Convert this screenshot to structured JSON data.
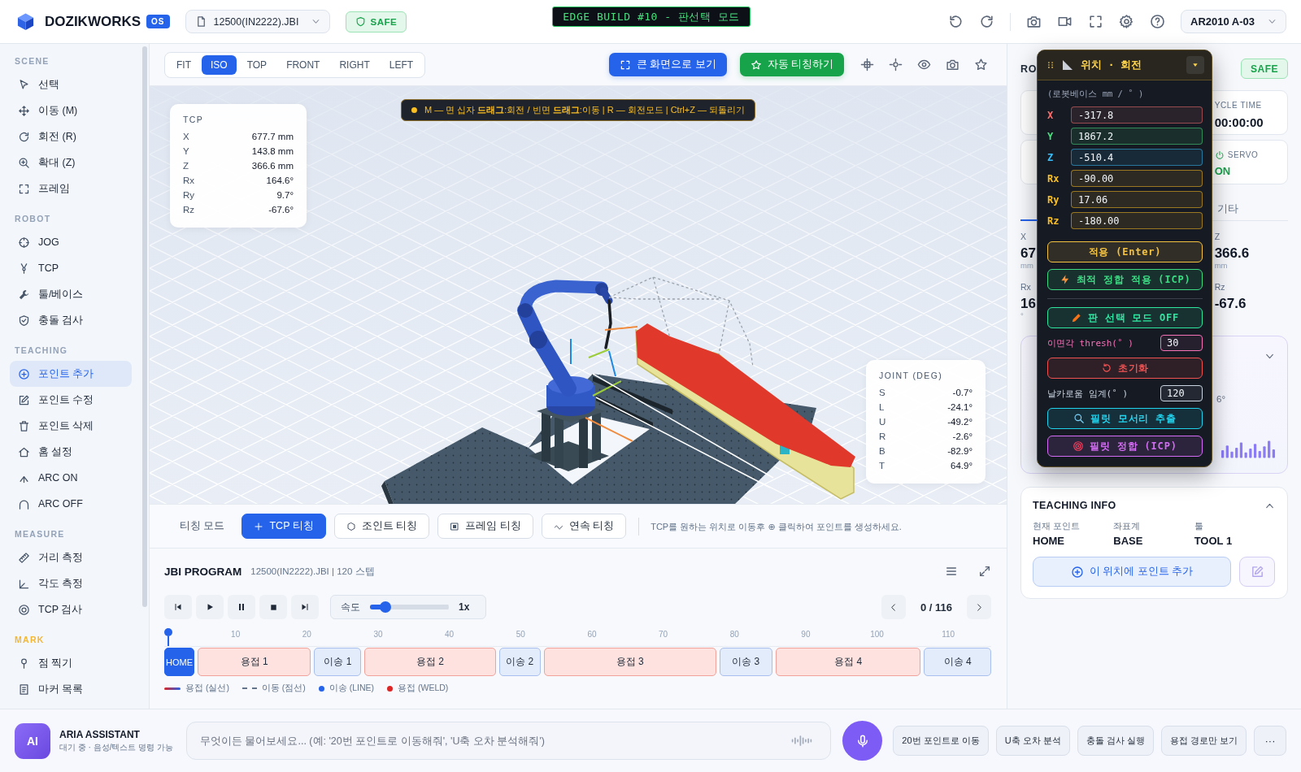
{
  "topbar": {
    "brand": "DOZIKWORKS",
    "brand_badge": "OS",
    "file": "12500(IN2222).JBI",
    "safety": "SAFE",
    "build_banner": "EDGE BUILD #10 - 판선택 모드",
    "robot": "AR2010 A-03"
  },
  "sidebar": {
    "sections": [
      {
        "title": "SCENE",
        "color": "#94a3b8",
        "items": [
          {
            "label": "선택",
            "selected": false
          },
          {
            "label": "이동 (M)",
            "selected": false
          },
          {
            "label": "회전 (R)",
            "selected": false
          },
          {
            "label": "확대 (Z)",
            "selected": false
          },
          {
            "label": "프레임",
            "selected": false
          }
        ]
      },
      {
        "title": "ROBOT",
        "color": "#94a3b8",
        "items": [
          {
            "label": "JOG",
            "selected": false
          },
          {
            "label": "TCP",
            "selected": false
          },
          {
            "label": "툴/베이스",
            "selected": false
          },
          {
            "label": "충돌 검사",
            "selected": false
          }
        ]
      },
      {
        "title": "TEACHING",
        "color": "#94a3b8",
        "items": [
          {
            "label": "포인트 추가",
            "selected": true
          },
          {
            "label": "포인트 수정",
            "selected": false
          },
          {
            "label": "포인트 삭제",
            "selected": false
          },
          {
            "label": "홈 설정",
            "selected": false
          },
          {
            "label": "ARC ON",
            "selected": false
          },
          {
            "label": "ARC OFF",
            "selected": false
          }
        ]
      },
      {
        "title": "MEASURE",
        "color": "#94a3b8",
        "items": [
          {
            "label": "거리 측정",
            "selected": false
          },
          {
            "label": "각도 측정",
            "selected": false
          },
          {
            "label": "TCP 검사",
            "selected": false
          }
        ]
      },
      {
        "title": "MARK",
        "color": "#f5b731",
        "items": [
          {
            "label": "점 찍기",
            "selected": false
          },
          {
            "label": "마커 목록",
            "selected": false
          }
        ]
      }
    ]
  },
  "viewport": {
    "views": [
      {
        "label": "FIT",
        "selected": false
      },
      {
        "label": "ISO",
        "selected": true
      },
      {
        "label": "TOP",
        "selected": false
      },
      {
        "label": "FRONT",
        "selected": false
      },
      {
        "label": "RIGHT",
        "selected": false
      },
      {
        "label": "LEFT",
        "selected": false
      }
    ],
    "actions": [
      {
        "label": "큰 화면으로 보기",
        "kind": "primary"
      },
      {
        "label": "자동 티칭하기",
        "kind": "success"
      }
    ],
    "hint": "M — 면 십자 **드래그**:회전 / 빈면 **드래그**:이동 | R — 회전모드 | Ctrl+Z — 되돌리기",
    "tcp": {
      "title": "TCP",
      "rows": [
        {
          "label": "X",
          "value": "677.7 mm"
        },
        {
          "label": "Y",
          "value": "143.8 mm"
        },
        {
          "label": "Z",
          "value": "366.6 mm"
        },
        {
          "label": "Rx",
          "value": "164.6°"
        },
        {
          "label": "Ry",
          "value": "9.7°"
        },
        {
          "label": "Rz",
          "value": "-67.6°"
        }
      ]
    },
    "joint": {
      "title": "JOINT (DEG)",
      "rows": [
        {
          "label": "S",
          "value": "-0.7°"
        },
        {
          "label": "L",
          "value": "-24.1°"
        },
        {
          "label": "U",
          "value": "-49.2°"
        },
        {
          "label": "R",
          "value": "-2.6°"
        },
        {
          "label": "B",
          "value": "-82.9°"
        },
        {
          "label": "T",
          "value": "64.9°"
        }
      ]
    }
  },
  "teaching_mode": {
    "label": "티칭 모드",
    "modes": [
      {
        "label": "TCP 티칭",
        "selected": true
      },
      {
        "label": "조인트 티칭",
        "selected": false
      },
      {
        "label": "프레임 티칭",
        "selected": false
      },
      {
        "label": "연속 티칭",
        "selected": false
      }
    ],
    "hint": "TCP를 원하는 위치로 이동후 ⊕ 클릭하여 포인트를 생성하세요."
  },
  "program": {
    "title": "JBI PROGRAM",
    "subtitle": "12500(IN2222).JBI | 120 스텝",
    "speed": {
      "label": "속도",
      "level": 0.2,
      "reading": "1x"
    },
    "step": "0 / 116",
    "timeline": {
      "ticks": [
        "10",
        "20",
        "30",
        "40",
        "50",
        "60",
        "70",
        "80",
        "90",
        "100",
        "110"
      ],
      "segments": [
        {
          "label": "HOME",
          "kind": "home"
        },
        {
          "label": "용접 1",
          "kind": "weld"
        },
        {
          "label": "이송 1",
          "kind": "move"
        },
        {
          "label": "용접 2",
          "kind": "weld"
        },
        {
          "label": "이송 2",
          "kind": "move"
        },
        {
          "label": "용접 3",
          "kind": "weld"
        },
        {
          "label": "이송 3",
          "kind": "move"
        },
        {
          "label": "용접 4",
          "kind": "weld"
        },
        {
          "label": "이송 4",
          "kind": "move"
        }
      ],
      "legend": [
        {
          "label": "용접 (실선)",
          "kind": "solid"
        },
        {
          "label": "이동 (점선)",
          "kind": "dashed"
        },
        {
          "label": "이송 (LINE)",
          "kind": "dot",
          "color": "#2563eb"
        },
        {
          "label": "용접 (WELD)",
          "kind": "dot",
          "color": "#dc2626"
        }
      ]
    }
  },
  "right_panel": {
    "title": "RO",
    "badge": "SAFE",
    "cards": [
      {
        "label": "YCLE TIME",
        "value": "00:00:00",
        "kind": "time"
      },
      {
        "label": "SERVO",
        "value": "ON",
        "kind": "power"
      }
    ],
    "tabs": [
      {
        "label": "기타",
        "selected": false
      }
    ],
    "values": [
      {
        "left": {
          "label": "X",
          "value": "67",
          "unit": "mm"
        },
        "right": {
          "label": "Z",
          "value": "366.6",
          "unit": "mm"
        }
      },
      {
        "left": {
          "label": "Rx",
          "value": "16",
          "unit": "°"
        },
        "right": {
          "label": "Rz",
          "value": "-67.6"
        }
      }
    ],
    "insight": {
      "text": "6°"
    },
    "teaching_info": {
      "title": "TEACHING INFO",
      "fields": [
        {
          "label": "현재 포인트",
          "value": "HOME"
        },
        {
          "label": "좌표계",
          "value": "BASE"
        },
        {
          "label": "툴",
          "value": "TOOL 1"
        }
      ],
      "add_button": "이 위치에 포인트 추가"
    }
  },
  "transform_panel": {
    "title": "위치 · 회전",
    "subtitle": "(로봇베이스 mm / ˚ )",
    "fields": [
      {
        "axis": "X",
        "value": "-317.8",
        "color": "#f87171"
      },
      {
        "axis": "Y",
        "value": "1867.2",
        "color": "#4ade80"
      },
      {
        "axis": "Z",
        "value": "-510.4",
        "color": "#38bdf8"
      },
      {
        "axis": "Rx",
        "value": "-90.00",
        "color": "#fbbf24"
      },
      {
        "axis": "Ry",
        "value": "17.06",
        "color": "#fbbf24"
      },
      {
        "axis": "Rz",
        "value": "-180.00",
        "color": "#fbbf24"
      }
    ],
    "controls": [
      {
        "kind": "button",
        "label": "적용 (Enter)",
        "color": "#f5c342"
      },
      {
        "kind": "button",
        "label": "최적 정합 적용 (ICP)",
        "color": "#3ddc84"
      },
      {
        "kind": "divider"
      },
      {
        "kind": "button",
        "label": "판 선택 모드 OFF",
        "color": "#2ee6a0"
      },
      {
        "kind": "setting",
        "label": "이면각 thresh(˚ )",
        "value": "30",
        "color": "#f472b6"
      },
      {
        "kind": "button",
        "label": "초기화",
        "color": "#f05252"
      },
      {
        "kind": "setting",
        "label": "날카로움 임계(˚ )",
        "value": "120",
        "color": "#cbd5e1"
      },
      {
        "kind": "button",
        "label": "필릿 모서리 추출",
        "color": "#22d3ee"
      },
      {
        "kind": "button",
        "label": "필릿 정합 (ICP)",
        "color": "#d56cf5"
      }
    ]
  },
  "assistant": {
    "avatar": "AI",
    "name": "ARIA ASSISTANT",
    "status": "대기 중 · 음성/텍스트 명령 가능",
    "placeholder": "무엇이든 물어보세요... (예: '20번 포인트로 이동해줘', 'U축 오차 분석해줘')",
    "chips": [
      "20번 포인트로 이동",
      "U축 오차 분석",
      "충돌 검사 실행",
      "용접 경로만 보기"
    ],
    "more": "···"
  }
}
